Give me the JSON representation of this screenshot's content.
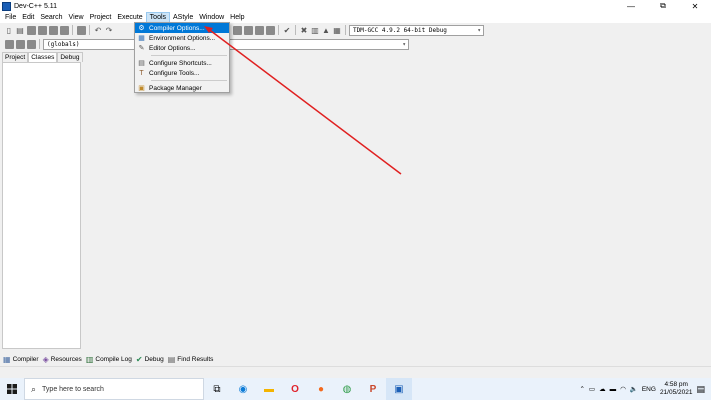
{
  "window": {
    "title": "Dev-C++ 5.11",
    "controls": {
      "minimize": "—",
      "restore": "⧉",
      "close": "✕"
    }
  },
  "menubar": {
    "items": [
      {
        "label": "File"
      },
      {
        "label": "Edit"
      },
      {
        "label": "Search"
      },
      {
        "label": "View"
      },
      {
        "label": "Project"
      },
      {
        "label": "Execute"
      },
      {
        "label": "Tools",
        "active": true
      },
      {
        "label": "AStyle"
      },
      {
        "label": "Window"
      },
      {
        "label": "Help"
      }
    ]
  },
  "toolbar": {
    "compiler_combo": "TDM-GCC 4.9.2 64-bit Debug",
    "scope_combo": "(globals)"
  },
  "tools_menu": {
    "items": [
      {
        "label": "Compiler Options...",
        "icon": "compiler-options-icon",
        "glyph": "⚙",
        "highlight": true
      },
      {
        "label": "Environment Options...",
        "icon": "environment-options-icon",
        "glyph": "▦"
      },
      {
        "label": "Editor Options...",
        "icon": "editor-options-icon",
        "glyph": "✎"
      },
      {
        "label": "Configure Shortcuts...",
        "icon": "shortcuts-icon",
        "glyph": "▤"
      },
      {
        "label": "Configure Tools...",
        "icon": "configure-tools-icon",
        "glyph": "🔨"
      },
      {
        "label": "Package Manager",
        "icon": "package-manager-icon",
        "glyph": "▣"
      }
    ]
  },
  "left_panel": {
    "tabs": [
      {
        "label": "Project"
      },
      {
        "label": "Classes",
        "active": true
      },
      {
        "label": "Debug"
      }
    ]
  },
  "bottom_tabs": [
    {
      "label": "Compiler",
      "icon": "compiler-grid-icon",
      "glyph": "▦"
    },
    {
      "label": "Resources",
      "icon": "resources-icon",
      "glyph": "◈"
    },
    {
      "label": "Compile Log",
      "icon": "compile-log-icon",
      "glyph": "▥"
    },
    {
      "label": "Debug",
      "icon": "debug-check-icon",
      "glyph": "✔"
    },
    {
      "label": "Find Results",
      "icon": "find-results-icon",
      "glyph": "▤"
    }
  ],
  "taskbar": {
    "search_placeholder": "Type here to search",
    "apps": [
      {
        "name": "task-view-icon",
        "glyph": "⧉"
      },
      {
        "name": "edge-icon",
        "glyph": "◉",
        "color": "#0c7bd7"
      },
      {
        "name": "file-explorer-icon",
        "glyph": "▬",
        "color": "#f4b400"
      },
      {
        "name": "opera-icon",
        "glyph": "O",
        "color": "#e0232b"
      },
      {
        "name": "firefox-icon",
        "glyph": "●",
        "color": "#f36a1e"
      },
      {
        "name": "chrome-icon",
        "glyph": "◍",
        "color": "#2e9b47"
      },
      {
        "name": "powerpoint-icon",
        "glyph": "P",
        "color": "#c9472b"
      },
      {
        "name": "devcpp-icon",
        "glyph": "▣",
        "color": "#1b5fb6"
      }
    ],
    "tray": {
      "language": "ENG",
      "time": "4:58 pm",
      "date": "21/05/2021"
    }
  }
}
